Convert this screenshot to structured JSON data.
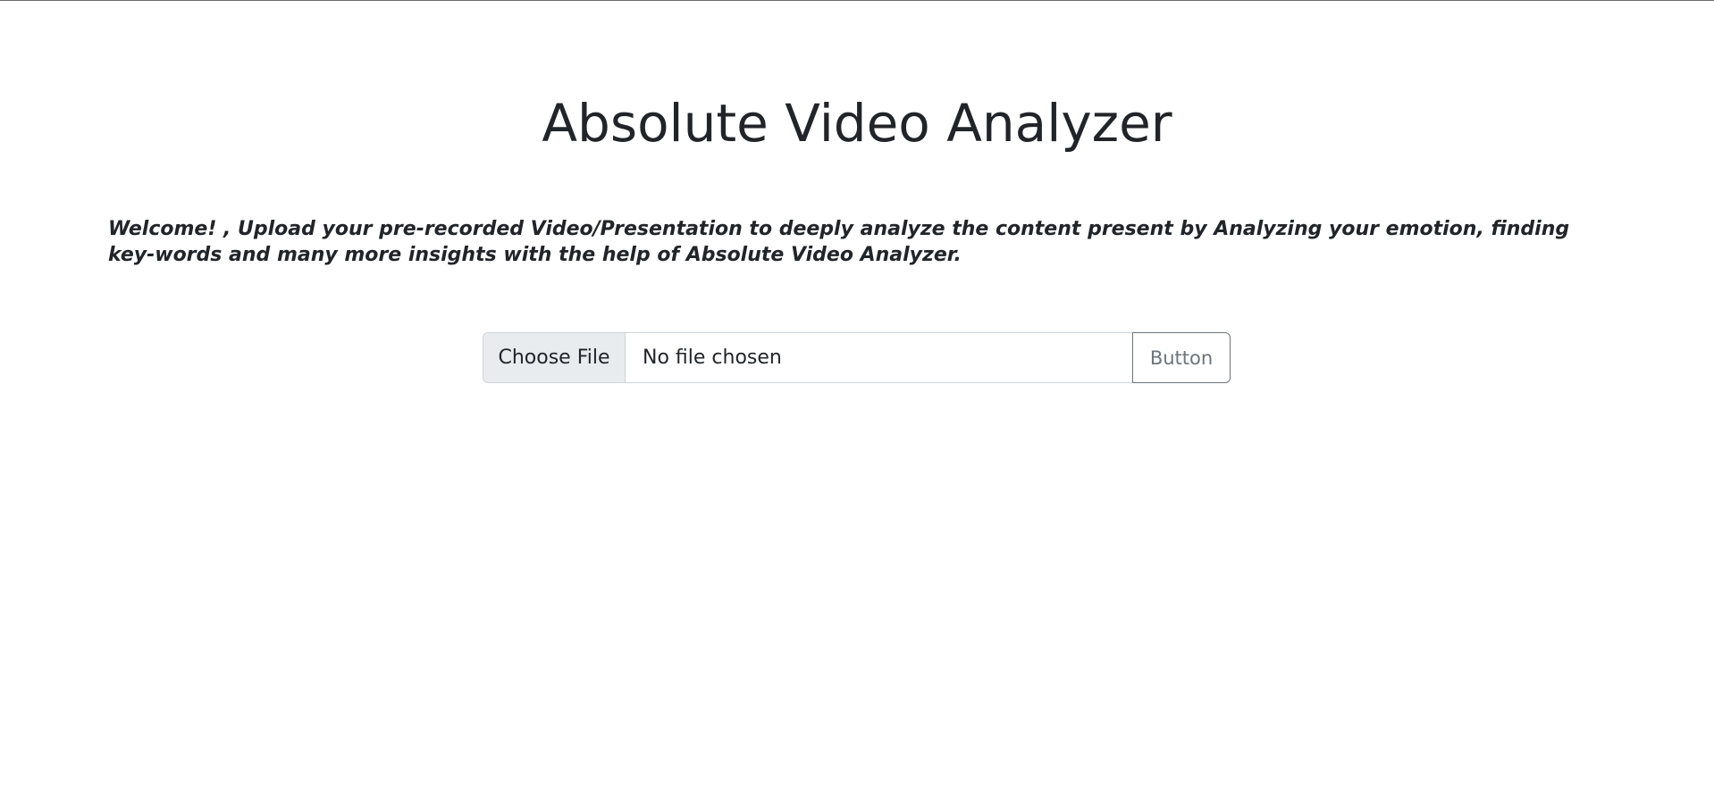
{
  "header": {
    "title": "Absolute Video Analyzer"
  },
  "intro": {
    "text": "Welcome! , Upload your pre-recorded Video/Presentation to deeply analyze the content present by Analyzing your emotion, finding key-words and many more insights with the help of Absolute Video Analyzer."
  },
  "upload": {
    "choose_label": "Choose File",
    "status": "No file chosen",
    "button_label": "Button"
  },
  "colors": {
    "text": "#212529",
    "border": "#ced4da",
    "choose_bg": "#e9ecef",
    "secondary": "#6c757d"
  }
}
